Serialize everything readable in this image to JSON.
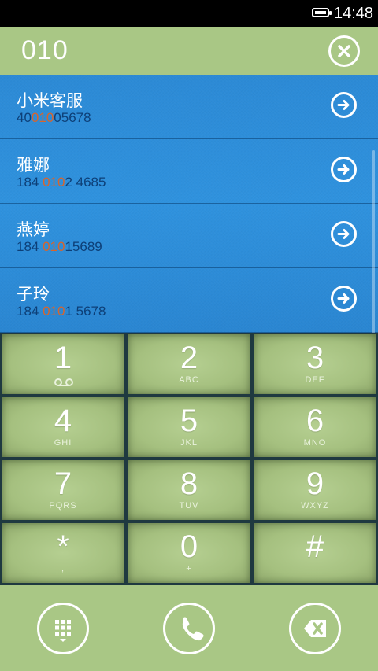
{
  "status": {
    "time": "14:48"
  },
  "header": {
    "number": "010"
  },
  "results": [
    {
      "name": "小米客服",
      "num_pre": "40",
      "num_hl": "010",
      "num_post": "05678"
    },
    {
      "name": "雅娜",
      "num_pre": "184 ",
      "num_hl": "010",
      "num_post": "2 4685"
    },
    {
      "name": "燕婷",
      "num_pre": "184 ",
      "num_hl": "010",
      "num_post": "15689"
    },
    {
      "name": "子玲",
      "num_pre": "184 ",
      "num_hl": "010",
      "num_post": "1 5678"
    }
  ],
  "keys": [
    {
      "digit": "1",
      "sub": ""
    },
    {
      "digit": "2",
      "sub": "ABC"
    },
    {
      "digit": "3",
      "sub": "DEF"
    },
    {
      "digit": "4",
      "sub": "GHI"
    },
    {
      "digit": "5",
      "sub": "JKL"
    },
    {
      "digit": "6",
      "sub": "MNO"
    },
    {
      "digit": "7",
      "sub": "PQRS"
    },
    {
      "digit": "8",
      "sub": "TUV"
    },
    {
      "digit": "9",
      "sub": "WXYZ"
    },
    {
      "digit": "*",
      "sub": ","
    },
    {
      "digit": "0",
      "sub": "+"
    },
    {
      "digit": "#",
      "sub": ""
    }
  ],
  "icons": {
    "battery": "battery-icon",
    "clear": "clear-input-icon",
    "go": "arrow-right-circle-icon",
    "voicemail": "voicemail-icon",
    "keypad": "keypad-icon",
    "call": "phone-icon",
    "delete": "backspace-icon"
  },
  "colors": {
    "accent_green": "#a9c785",
    "list_blue": "#2c8ad6",
    "match_orange": "#d9642b"
  }
}
